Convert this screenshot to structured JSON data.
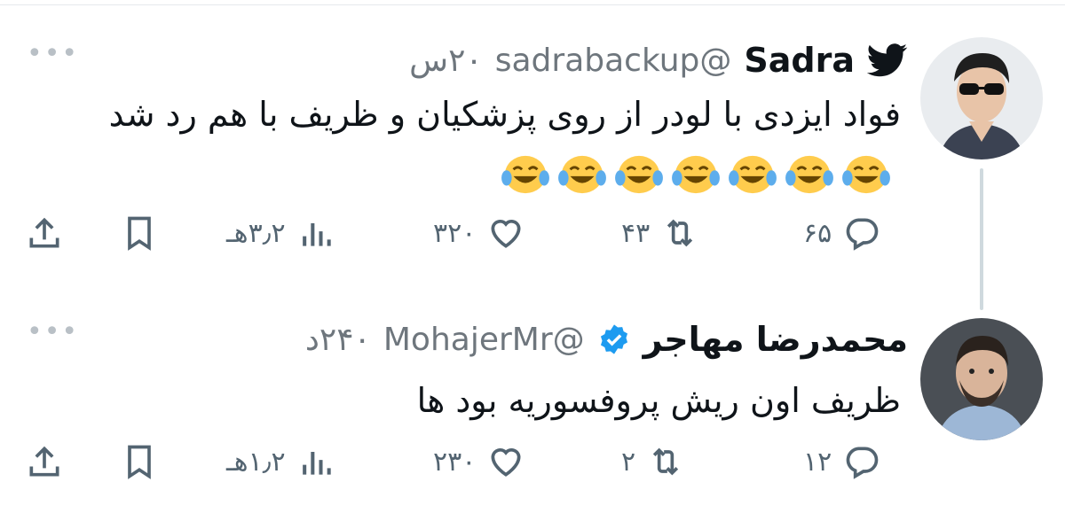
{
  "tweets": [
    {
      "name": "Sadra",
      "handle": "@sadrabackup",
      "time": "۲۰س",
      "text": "فواد ایزدی با لودر از روی پزشکیان و ظریف با هم رد شد",
      "emoji_count": 7,
      "stats": {
        "replies": "۶۵",
        "retweets": "۴۳",
        "likes": "۳۲۰",
        "views": "۳٫۲هـ"
      }
    },
    {
      "name": "محمدرضا مهاجر",
      "handle": "@MohajerMr",
      "time": "۲۴۰د",
      "text": "ظریف اون ریش پروفسوریه بود ها",
      "stats": {
        "replies": "۱۲",
        "retweets": "۲",
        "likes": "۲۳۰",
        "views": "۱٫۲هـ"
      }
    }
  ],
  "colors": {
    "text": "#0f1419",
    "secondary": "#536471",
    "verified": "#1d9bf0",
    "emoji": "#ffcc4d"
  },
  "icons": {
    "bird": "twitter-bird-icon",
    "verified": "verified-badge-icon",
    "more": "more-options-icon",
    "reply": "reply-icon",
    "retweet": "retweet-icon",
    "like": "heart-icon",
    "views": "views-icon",
    "bookmark": "bookmark-icon",
    "share": "share-icon"
  }
}
